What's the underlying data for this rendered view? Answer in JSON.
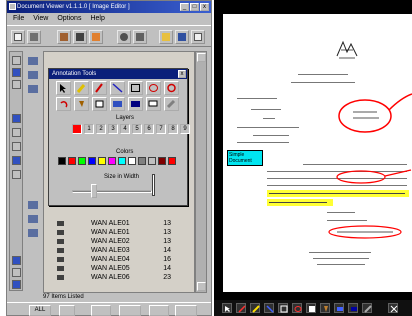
{
  "app": {
    "title": "Document Viewer v1.1.1.0 [ Image Editor ]",
    "window_buttons": [
      "_",
      "□",
      "x"
    ],
    "menu": [
      "File",
      "View",
      "Options",
      "Help"
    ]
  },
  "annotation_tools": {
    "title": "Annotation Tools",
    "close_label": "x",
    "layers_label": "Layers",
    "layer_numbers": [
      "1",
      "2",
      "3",
      "4",
      "5",
      "6",
      "7",
      "8",
      "9"
    ],
    "colors_label": "Colors",
    "size_label": "Size in Width",
    "palette": [
      "#000000",
      "#ff0000",
      "#00ff00",
      "#0000ff",
      "#ffff00",
      "#ff00ff",
      "#00ffff",
      "#ffffff",
      "#808080",
      "#c0c0c0",
      "#800000",
      "#ff0000"
    ],
    "size_value": 0.25
  },
  "list": {
    "items": [
      {
        "name": "WAN ALE01",
        "count": "13"
      },
      {
        "name": "WAN ALE01",
        "count": "13"
      },
      {
        "name": "WAN ALE02",
        "count": "13"
      },
      {
        "name": "WAN ALE03",
        "count": "14"
      },
      {
        "name": "WAN ALE04",
        "count": "16"
      },
      {
        "name": "WAN ALE05",
        "count": "14"
      },
      {
        "name": "WAN ALE06",
        "count": "23"
      }
    ],
    "status": "97 Items Listed"
  },
  "bottom": {
    "all_label": "ALL"
  },
  "document": {
    "callout_text": "Simple Document",
    "colors": {
      "highlight": "#ffff33",
      "callout": "#00e5f0",
      "annotation_red": "#ff0000"
    }
  }
}
